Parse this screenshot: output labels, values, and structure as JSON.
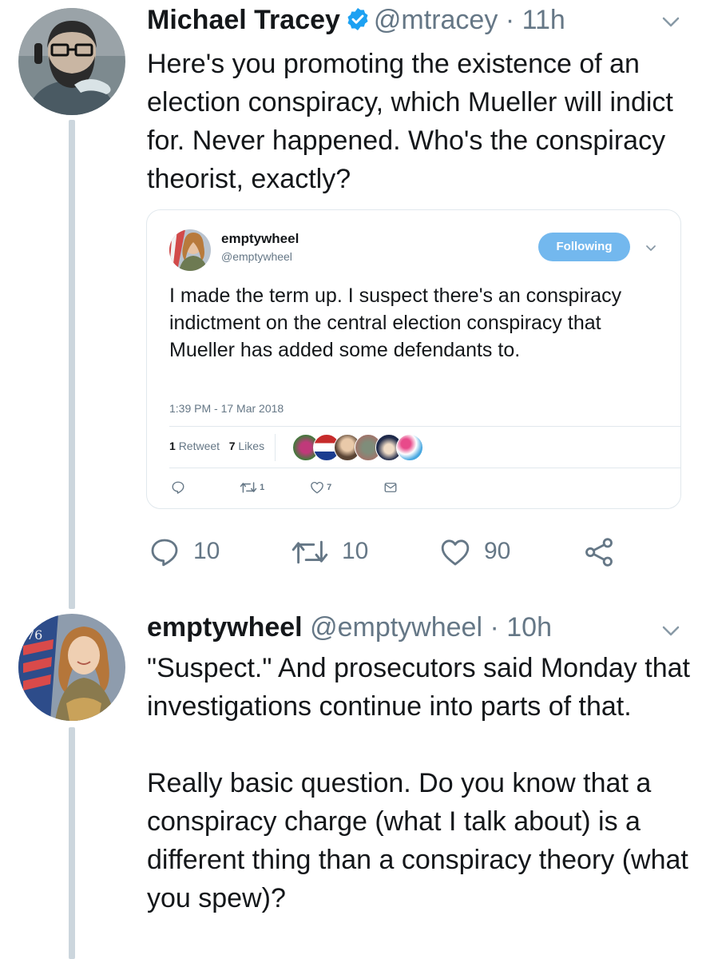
{
  "tweet1": {
    "name": "Michael Tracey",
    "handle": "@mtracey",
    "separator": "·",
    "time": "11h",
    "verified": true,
    "text": "Here's you promoting the existence of an election conspiracy, which Mueller will indict for. Never happened. Who's the conspiracy theorist, exactly?",
    "quoted": {
      "name": "emptywheel",
      "handle": "@emptywheel",
      "follow_label": "Following",
      "text": "I made the term up. I suspect there's an conspiracy indictment on the central election conspiracy that Mueller has added some defendants to.",
      "timestamp": "1:39 PM - 17 Mar 2018",
      "retweets_count": "1",
      "retweets_label": "Retweet",
      "likes_count": "7",
      "likes_label": "Likes",
      "reply_count": "",
      "retweet_action_count": "1",
      "like_action_count": "7"
    },
    "actions": {
      "replies": "10",
      "retweets": "10",
      "likes": "90"
    }
  },
  "tweet2": {
    "name": "emptywheel",
    "handle": "@emptywheel",
    "separator": "·",
    "time": "10h",
    "text": "\"Suspect.\" And prosecutors said Monday that investigations continue into parts of that.\n\nReally basic question. Do you know that a conspiracy charge (what I talk about) is a different thing than a conspiracy theory (what you spew)?"
  },
  "colors": {
    "accent": "#1da1f2",
    "muted": "#657786",
    "text": "#14171a",
    "thread_line": "#ccd6dd",
    "following_button": "#73b8ee"
  },
  "icons": {
    "verified": "verified-badge-icon",
    "caret": "chevron-down-icon",
    "reply": "reply-icon",
    "retweet": "retweet-icon",
    "like": "heart-icon",
    "share": "share-icon",
    "dm": "envelope-icon"
  }
}
